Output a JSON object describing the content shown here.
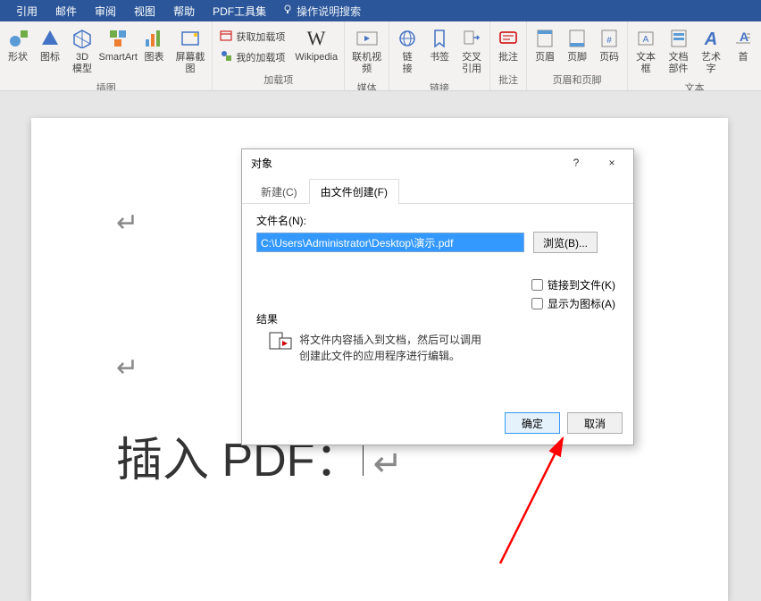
{
  "menubar": {
    "items": [
      "引用",
      "邮件",
      "审阅",
      "视图",
      "帮助",
      "PDF工具集"
    ],
    "tell_me": "操作说明搜索"
  },
  "ribbon": {
    "groups": [
      {
        "label": "插图",
        "items": [
          {
            "label": "形状",
            "icon": "shapes-icon"
          },
          {
            "label": "图标",
            "icon": "icons-icon"
          },
          {
            "label": "3D\n模型",
            "icon": "3d-icon"
          },
          {
            "label": "SmartArt",
            "icon": "smartart-icon"
          },
          {
            "label": "图表",
            "icon": "chart-icon"
          },
          {
            "label": "屏幕截图",
            "icon": "screenshot-icon"
          }
        ]
      },
      {
        "label": "加载项",
        "items": [
          {
            "label": "获取加载项",
            "icon": "store-icon",
            "small": true
          },
          {
            "label": "我的加载项",
            "icon": "myaddins-icon",
            "small": true
          },
          {
            "label": "Wikipedia",
            "icon": "wikipedia-icon"
          }
        ]
      },
      {
        "label": "媒体",
        "items": [
          {
            "label": "联机视频",
            "icon": "video-icon"
          }
        ]
      },
      {
        "label": "链接",
        "items": [
          {
            "label": "链\n接",
            "icon": "link-icon"
          },
          {
            "label": "书签",
            "icon": "bookmark-icon"
          },
          {
            "label": "交叉引用",
            "icon": "crossref-icon"
          }
        ]
      },
      {
        "label": "批注",
        "items": [
          {
            "label": "批注",
            "icon": "comment-icon"
          }
        ]
      },
      {
        "label": "页眉和页脚",
        "items": [
          {
            "label": "页眉",
            "icon": "header-icon"
          },
          {
            "label": "页脚",
            "icon": "footer-icon"
          },
          {
            "label": "页码",
            "icon": "pagenum-icon"
          }
        ]
      },
      {
        "label": "文本",
        "items": [
          {
            "label": "文本框",
            "icon": "textbox-icon"
          },
          {
            "label": "文档部件",
            "icon": "quickparts-icon"
          },
          {
            "label": "艺术字",
            "icon": "wordart-icon"
          },
          {
            "label": "首",
            "icon": "dropcap-icon"
          }
        ]
      }
    ]
  },
  "document": {
    "text": "插入 PDF："
  },
  "dialog": {
    "title": "对象",
    "help": "?",
    "close": "×",
    "tabs": [
      "新建(C)",
      "由文件创建(F)"
    ],
    "active_tab": 1,
    "filename_label": "文件名(N):",
    "filename_value": "C:\\Users\\Administrator\\Desktop\\演示.pdf",
    "browse": "浏览(B)...",
    "link_checkbox": "链接到文件(K)",
    "icon_checkbox": "显示为图标(A)",
    "result_label": "结果",
    "result_text": "将文件内容插入到文档，然后可以调用创建此文件的应用程序进行编辑。",
    "ok": "确定",
    "cancel": "取消"
  }
}
